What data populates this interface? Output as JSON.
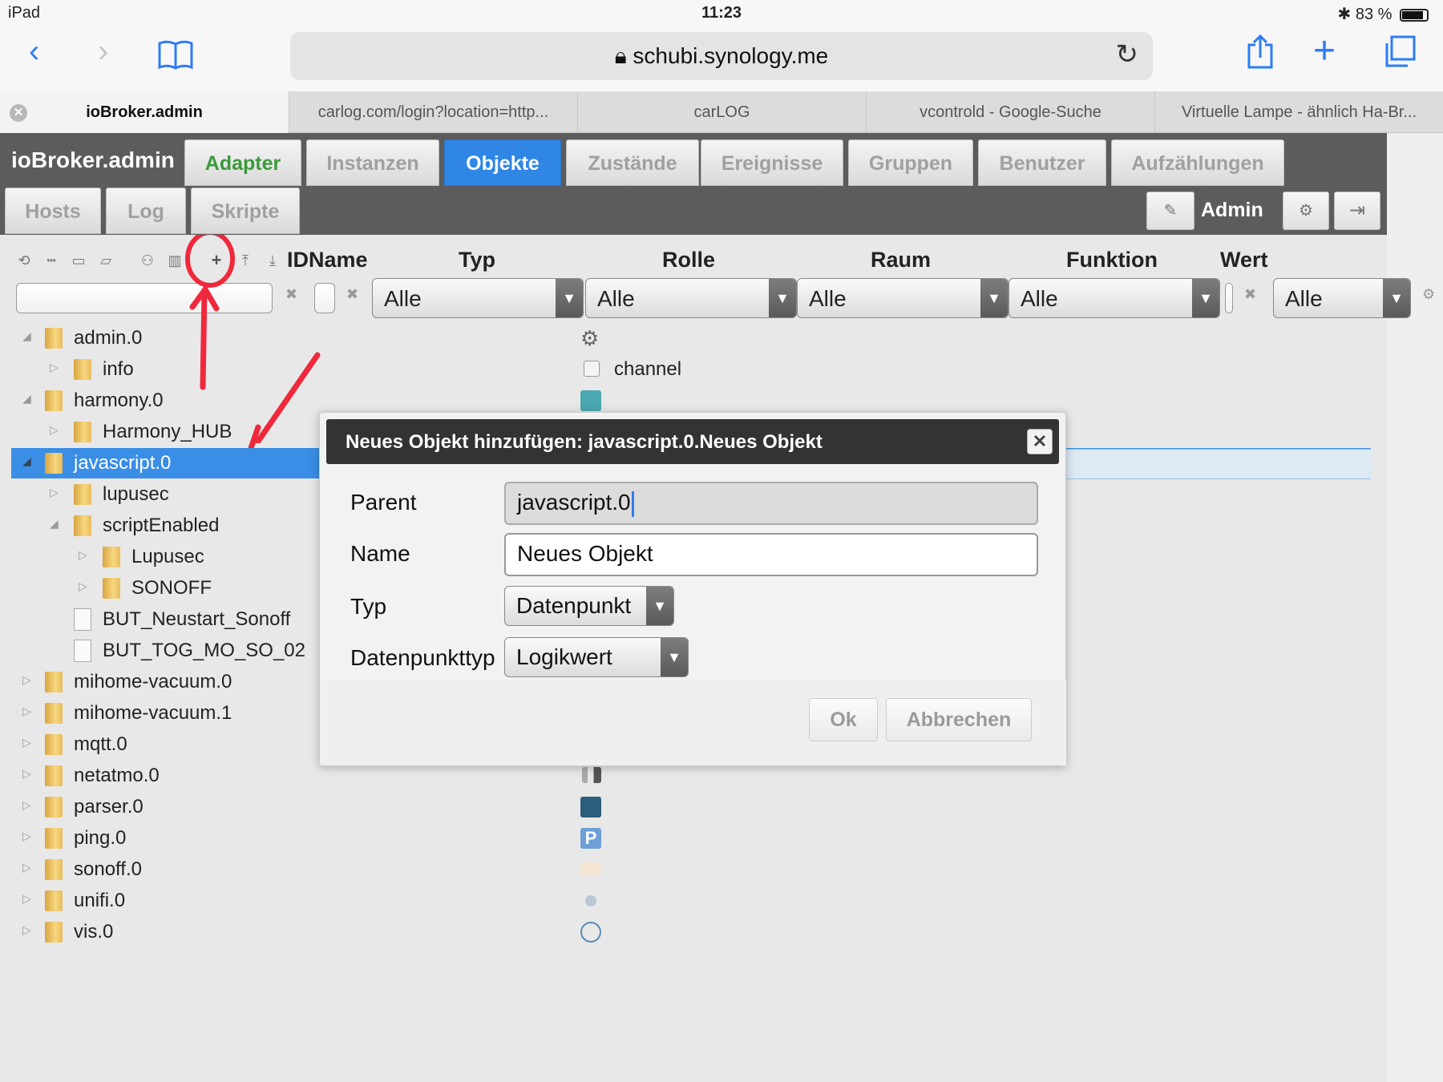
{
  "status": {
    "device": "iPad",
    "time": "11:23",
    "battery": "83 %"
  },
  "browser": {
    "url": "schubi.synology.me",
    "icons": {
      "back": "chevron-left-icon",
      "forward": "chevron-right-icon",
      "bookmarks": "book-icon",
      "reload": "reload-icon",
      "share": "share-icon",
      "newtab": "plus-icon",
      "tabs": "tabs-icon"
    },
    "tabs": [
      {
        "label": "ioBroker.admin"
      },
      {
        "label": "carlog.com/login?location=http..."
      },
      {
        "label": "carLOG"
      },
      {
        "label": "vcontrold - Google-Suche"
      },
      {
        "label": "Virtuelle Lampe - ähnlich Ha-Br..."
      }
    ]
  },
  "app": {
    "title": "ioBroker.admin",
    "nav": [
      "Adapter",
      "Instanzen",
      "Objekte",
      "Zustände",
      "Ereignisse",
      "Gruppen",
      "Benutzer",
      "Aufzählungen"
    ],
    "nav2": [
      "Hosts",
      "Log",
      "Skripte"
    ],
    "user": "Admin"
  },
  "grid": {
    "headers": {
      "id": "IDName",
      "typ": "Typ",
      "rolle": "Rolle",
      "raum": "Raum",
      "funktion": "Funktion",
      "wert": "Wert"
    },
    "filter": {
      "typ": "Alle",
      "rolle": "Alle",
      "raum": "Alle",
      "funktion": "Alle",
      "wert": "Alle"
    },
    "rows": [
      {
        "label": "admin.0",
        "type": ""
      },
      {
        "label": "info",
        "type": "channel"
      },
      {
        "label": "harmony.0",
        "type": ""
      },
      {
        "label": "Harmony_HUB",
        "type": ""
      },
      {
        "label": "javascript.0",
        "type": ""
      },
      {
        "label": "lupusec",
        "type": ""
      },
      {
        "label": "scriptEnabled",
        "type": ""
      },
      {
        "label": "Lupusec",
        "type": ""
      },
      {
        "label": "SONOFF",
        "type": ""
      },
      {
        "label": "BUT_Neustart_Sonoff",
        "type": ""
      },
      {
        "label": "BUT_TOG_MO_SO_02",
        "type": ""
      },
      {
        "label": "mihome-vacuum.0",
        "type": ""
      },
      {
        "label": "mihome-vacuum.1",
        "type": ""
      },
      {
        "label": "mqtt.0",
        "type": ""
      },
      {
        "label": "netatmo.0",
        "type": ""
      },
      {
        "label": "parser.0",
        "type": ""
      },
      {
        "label": "ping.0",
        "type": ""
      },
      {
        "label": "sonoff.0",
        "type": ""
      },
      {
        "label": "unifi.0",
        "type": ""
      },
      {
        "label": "vis.0",
        "type": ""
      }
    ]
  },
  "dialog": {
    "title": "Neues Objekt hinzufügen: javascript.0.Neues Objekt",
    "parent_label": "Parent",
    "parent_value": "javascript.0",
    "name_label": "Name",
    "name_value": "Neues Objekt",
    "typ_label": "Typ",
    "typ_value": "Datenpunkt",
    "dptyp_label": "Datenpunkttyp",
    "dptyp_value": "Logikwert",
    "ok": "Ok",
    "cancel": "Abbrechen"
  }
}
